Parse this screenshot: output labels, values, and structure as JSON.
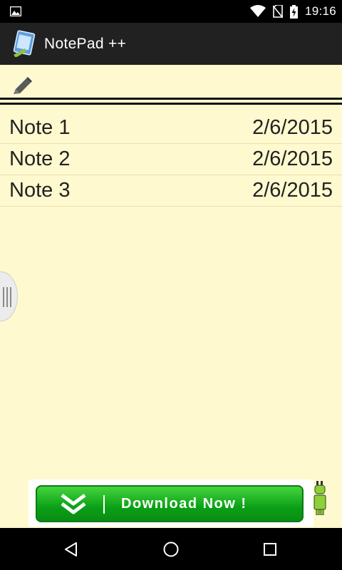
{
  "status_bar": {
    "time": "19:16"
  },
  "app": {
    "title": "NotePad ++"
  },
  "notes": [
    {
      "title": "Note 1",
      "date": "2/6/2015"
    },
    {
      "title": "Note 2",
      "date": "2/6/2015"
    },
    {
      "title": "Note 3",
      "date": "2/6/2015"
    }
  ],
  "ad": {
    "label": "Download Now !"
  },
  "icons": {
    "status": [
      "gallery-icon",
      "wifi-icon",
      "no-sim-icon",
      "battery-charging-icon"
    ],
    "toolbar": "pencil-icon",
    "nav": [
      "back-icon",
      "home-icon",
      "recents-icon"
    ]
  },
  "colors": {
    "background": "#fef9cf",
    "action_bar": "#212121",
    "ad_green": "#0aa017"
  }
}
